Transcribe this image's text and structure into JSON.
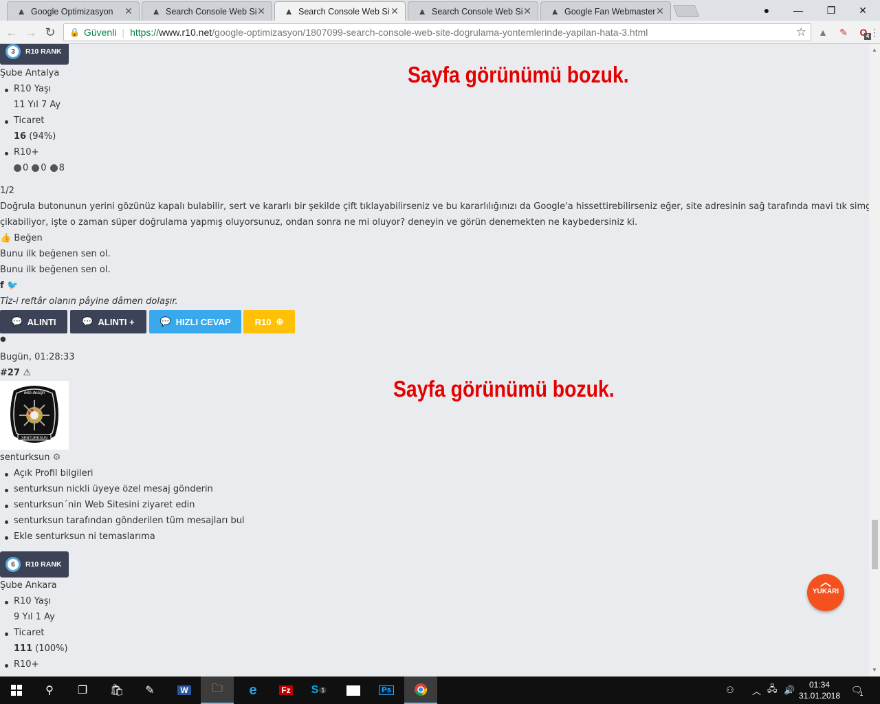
{
  "browser": {
    "tabs": [
      {
        "title": "Google Optimizasyon"
      },
      {
        "title": "Search Console Web Site"
      },
      {
        "title": "Search Console Web Site"
      },
      {
        "title": "Search Console Web Site"
      },
      {
        "title": "Google Fan Webmaster F"
      }
    ],
    "secure_label": "Güvenli",
    "url_scheme": "https://",
    "url_host": "www.r10.net",
    "url_path": "/google-optimizasyon/1807099-search-console-web-site-dogrulama-yontemlerinde-yapilan-hata-3.html",
    "opera_badge": "4"
  },
  "post1": {
    "rank_number": "3",
    "rank_label": "R10 RANK",
    "branch": "Şube Antalya",
    "age_label": "R10 Yaşı",
    "age_value": "11 Yıl 7 Ay",
    "trade_label": "Ticaret",
    "trade_count": "16",
    "trade_pct": "(94%)",
    "plus_label": "R10+",
    "plus_values": [
      "0",
      "0",
      "8"
    ],
    "page": "1/2",
    "body_line1": "Doğrula butonunun yerini gözünüz kapalı bulabilir, sert ve kararlı bir şekilde çift tıklayabilirseniz ve bu kararlılığınızı da Google'a hissettirebilirseniz eğer, site adresinin sağ tarafında mavi tık simgesi",
    "body_line2": "çikabiliyor, işte o zaman süper doğrulama yapmış oluyorsunuz, ondan sonra ne mi oluyor? deneyin ve görün denemekten ne kaybedersiniz ki.",
    "like_label": "Beğen",
    "first_like_1": "Bunu ilk beğenen sen ol.",
    "first_like_2": "Bunu ilk beğenen sen ol.",
    "signature": "Tîz-i reftâr olanın pâyine dâmen dolaşır.",
    "buttons": {
      "quote": "ALINTI",
      "quote_plus": "ALINTI +",
      "quick_reply": "HIZLI CEVAP",
      "r10": "R10"
    }
  },
  "post2": {
    "date": "Bugün, 01:28:33",
    "number": "#27",
    "avatar_text_top": "web design",
    "avatar_text_bottom": "SENTURKSUN",
    "username": "senturksun",
    "menu": [
      "Açık Profil bilgileri",
      "senturksun nickli üyeye özel mesaj gönderin",
      "senturksun´nin Web Sitesini ziyaret edin",
      "senturksun tarafından gönderilen tüm mesajları bul",
      "Ekle senturksun ni temaslarıma"
    ],
    "rank_number": "6",
    "rank_label": "R10 RANK",
    "branch": "Şube Ankara",
    "age_label": "R10 Yaşı",
    "age_value": "9 Yıl 1 Ay",
    "trade_label": "Ticaret",
    "trade_count": "111",
    "trade_pct": "(100%)",
    "plus_label": "R10+"
  },
  "overlay": {
    "note_1": "Sayfa görünümü bozuk.",
    "note_2": "Sayfa görünümü bozuk."
  },
  "scroll_top_label": "YUKARI",
  "taskbar": {
    "time": "01:34",
    "date": "31.01.2018",
    "notif_count": "1",
    "skype_badge": "1"
  },
  "colors": {
    "btn_dark": "#3d4356",
    "btn_blue": "#38a9ec",
    "btn_yellow": "#ffc107",
    "overlay_red": "#e50000",
    "yukari": "#f4511e"
  }
}
